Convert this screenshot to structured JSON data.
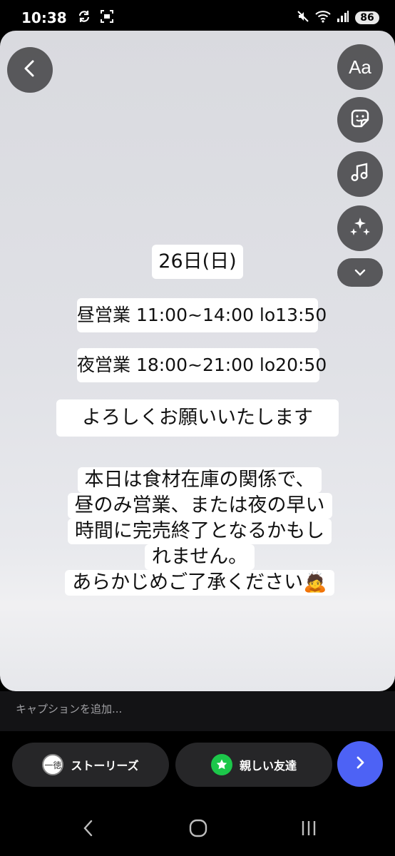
{
  "status_bar": {
    "time": "10:38",
    "battery": "86",
    "icons": [
      "sync-icon",
      "screenshot-icon",
      "mute-icon",
      "wifi-icon",
      "signal-icon"
    ]
  },
  "toolbar": {
    "text_tool_label": "Aa",
    "icons": [
      "back-icon",
      "sticker-icon",
      "music-icon",
      "effects-icon",
      "chevron-down-icon"
    ]
  },
  "story": {
    "date": "26日(日)",
    "lunch_hours": "昼営業 11:00~14:00 lo13:50",
    "dinner_hours": "夜営業 18:00~21:00 lo20:50",
    "greeting": "よろしくお願いいたします",
    "notice_lines": [
      "本日は食材在庫の関係で、",
      "昼のみ営業、または夜の早い",
      "時間に完売終了となるかもし",
      "れません。",
      "あらかじめご了承ください🙇"
    ]
  },
  "caption": {
    "placeholder": "キャプションを追加..."
  },
  "share": {
    "stories_label": "ストーリーズ",
    "close_friends_label": "親しい友達",
    "avatar_text": "一徳"
  },
  "colors": {
    "canvas": "#dfe0e5",
    "next_button": "#4d62f5",
    "close_friends": "#1cc74a"
  }
}
